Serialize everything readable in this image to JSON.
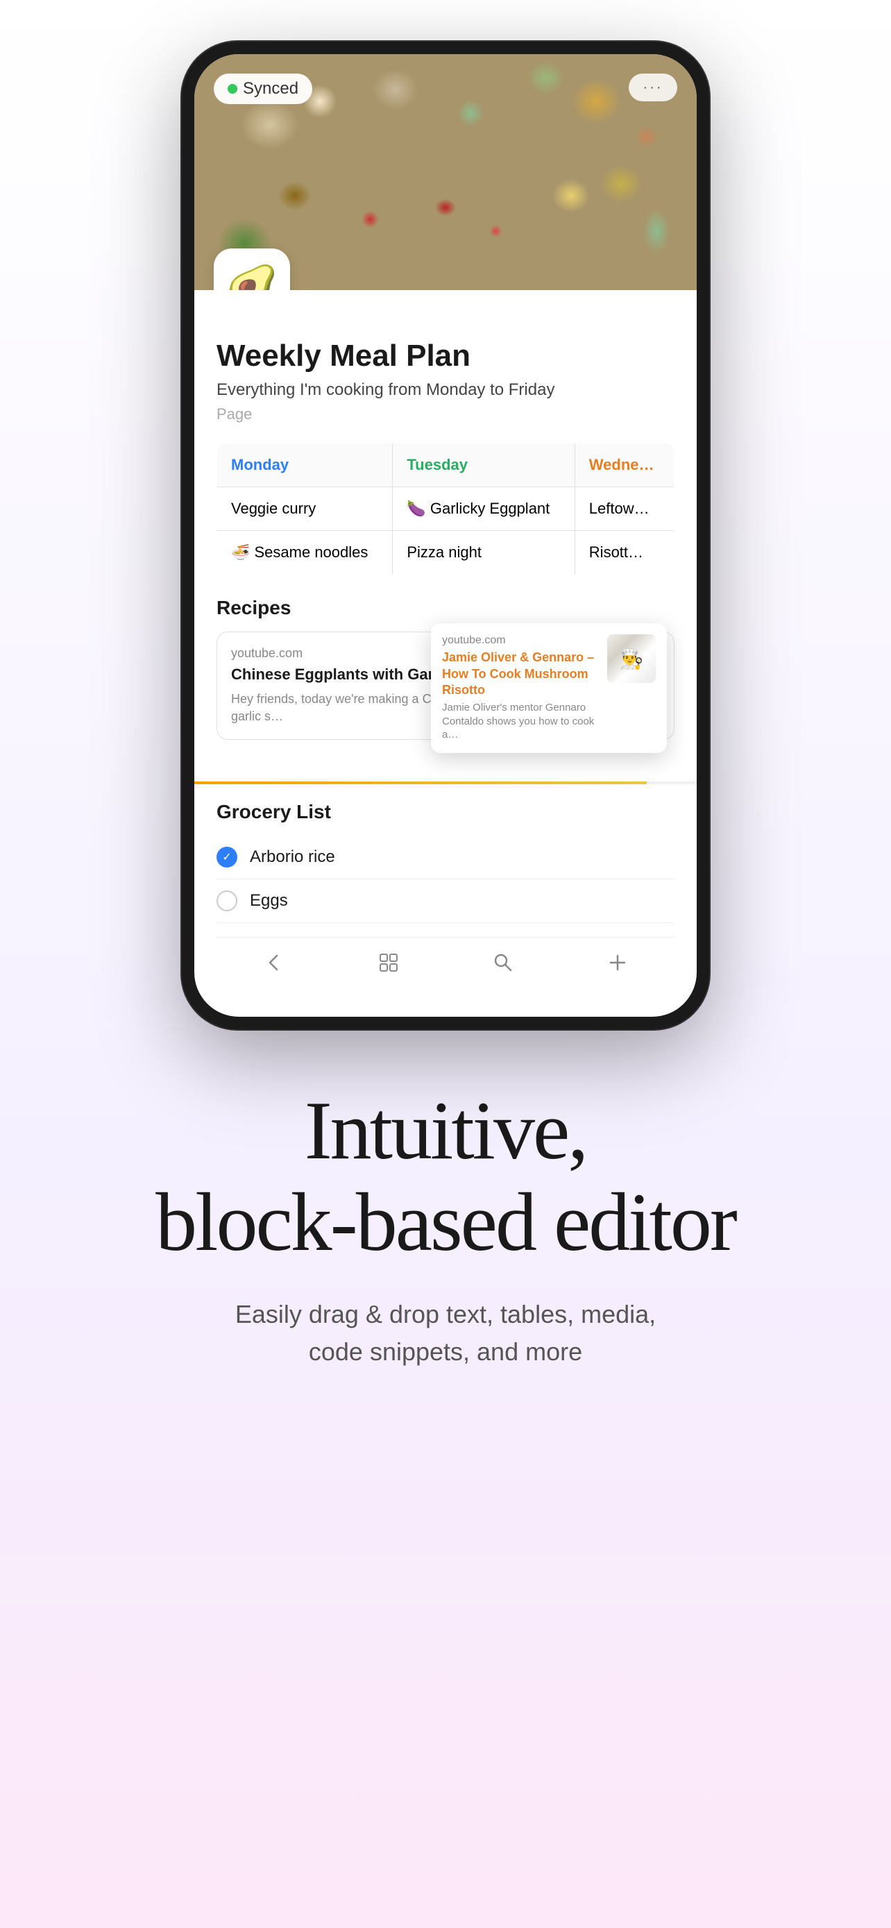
{
  "phone": {
    "synced_label": "Synced",
    "more_label": "···",
    "app_icon_emoji": "🥑",
    "page_title": "Weekly Meal Plan",
    "page_subtitle": "Everything I'm cooking from Monday to Friday",
    "page_type": "Page",
    "table": {
      "headers": [
        "Monday",
        "Tuesday",
        "Wedne…"
      ],
      "rows": [
        [
          "Veggie curry",
          "🍆 Garlicky Eggplant",
          "Leftow…"
        ],
        [
          "🍜 Sesame noodles",
          "Pizza night",
          "Risott…"
        ]
      ]
    },
    "recipes_header": "Recipes",
    "recipe1": {
      "source": "youtube.com",
      "title": "Chinese Eggplants with Garlic Sauce",
      "description": "Hey friends, today we're making a Chinese dish: eggplants with garlic s…"
    },
    "recipe2_popup": {
      "source": "youtube.com",
      "title": "Jamie Oliver & Gennaro – How To Cook Mushroom Risotto",
      "description": "Jamie Oliver's mentor Gennaro Contaldo shows you how to cook a…"
    },
    "grocery_header": "Grocery List",
    "grocery_items": [
      {
        "text": "Arborio rice",
        "checked": true
      },
      {
        "text": "Eggs",
        "checked": false
      }
    ]
  },
  "headline": {
    "main": "Intuitive,\nblock-based editor",
    "sub": "Easily drag & drop text, tables, media,\ncode snippets, and more"
  }
}
